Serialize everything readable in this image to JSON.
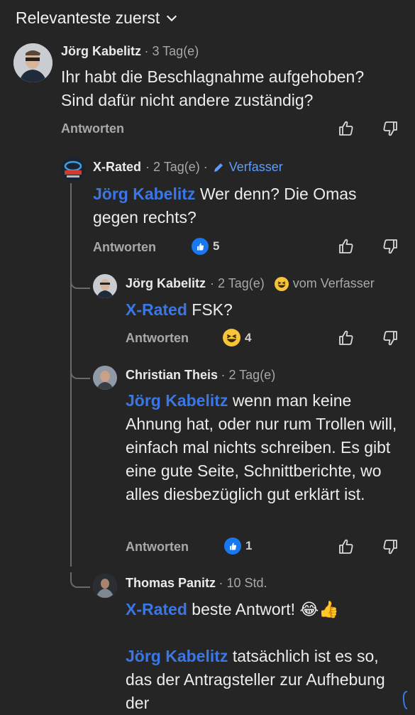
{
  "sort": {
    "label": "Relevanteste zuerst"
  },
  "comments": [
    {
      "name": "Jörg Kabelitz",
      "time": "· 3 Tag(e)",
      "text": "Ihr habt die Beschlagnahme aufgehoben? Sind dafür nicht andere zuständig?",
      "reply": "Antworten"
    },
    {
      "name": "X-Rated",
      "time": "· 2 Tag(e) ·",
      "author_badge": "Verfasser",
      "mention": "Jörg Kabelitz",
      "text": "Wer denn? Die Omas gegen rechts?",
      "reply": "Antworten",
      "reaction": "like",
      "count": "5"
    },
    {
      "name": "Jörg Kabelitz",
      "time": "· 2 Tag(e)",
      "badge": "vom Verfasser",
      "mention": "X-Rated",
      "text": "FSK?",
      "reply": "Antworten",
      "reaction": "haha",
      "count": "4"
    },
    {
      "name": "Christian Theis",
      "time": "· 2 Tag(e)",
      "mention": "Jörg Kabelitz",
      "text": "wenn man keine Ahnung hat, oder nur rum Trollen will, einfach mal nichts schreiben. Es gibt eine gute Seite, Schnittberichte, wo alles diesbezüglich gut erklärt ist.",
      "reply": "Antworten",
      "reaction": "like",
      "count": "1"
    },
    {
      "name": "Thomas Panitz",
      "time": "· 10 Std.",
      "mention": "X-Rated",
      "text": "beste Antwort! 😂👍",
      "mention2": "Jörg Kabelitz",
      "text2": "tatsächlich ist es so, das der Antragsteller zur Aufhebung der"
    }
  ],
  "colors": {
    "background": "#252525",
    "mention": "#3b76e6",
    "like": "#1877f2",
    "haha": "#f7c33b"
  }
}
